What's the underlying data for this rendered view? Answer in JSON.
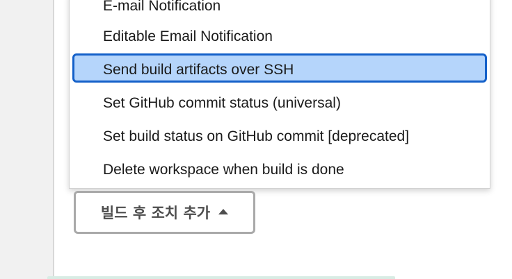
{
  "dropdown": {
    "items": [
      {
        "label": "E-mail Notification",
        "selected": false
      },
      {
        "label": "Editable Email Notification",
        "selected": false
      },
      {
        "label": "Send build artifacts over SSH",
        "selected": true
      },
      {
        "label": "Set GitHub commit status (universal)",
        "selected": false
      },
      {
        "label": "Set build status on GitHub commit [deprecated]",
        "selected": false
      },
      {
        "label": "Delete workspace when build is done",
        "selected": false
      }
    ]
  },
  "add_post_build_button": {
    "label": "빌드 후 조치 추가",
    "icon": "caret-up-icon"
  },
  "colors": {
    "highlight_bg": "#b5d5fb",
    "highlight_border": "#1460c9",
    "button_border": "#a9a9a9"
  }
}
